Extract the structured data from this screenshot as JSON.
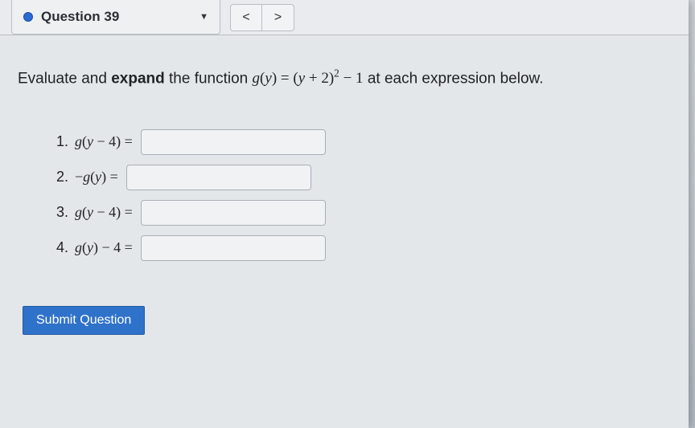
{
  "header": {
    "title": "Question 39",
    "prev": "<",
    "next": ">"
  },
  "prompt": {
    "part1": "Evaluate and ",
    "bold": "expand",
    "part2": " the function ",
    "function_latex": "g(y) = (y + 2)^2 - 1",
    "part3": " at each expression below."
  },
  "items": [
    {
      "num": "1.",
      "expr": "g(y - 4) =",
      "value": ""
    },
    {
      "num": "2.",
      "expr": "-g(y) =",
      "value": ""
    },
    {
      "num": "3.",
      "expr": "g(y - 4) =",
      "value": ""
    },
    {
      "num": "4.",
      "expr": "g(y) - 4 =",
      "value": ""
    }
  ],
  "buttons": {
    "submit": "Submit Question"
  }
}
